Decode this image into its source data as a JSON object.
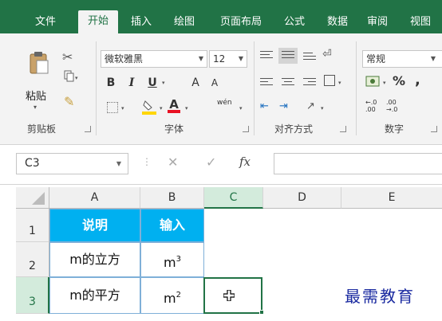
{
  "tabs": [
    {
      "label": "文件",
      "active": false
    },
    {
      "label": "开始",
      "active": true
    },
    {
      "label": "插入",
      "active": false
    },
    {
      "label": "绘图",
      "active": false
    },
    {
      "label": "页面布局",
      "active": false
    },
    {
      "label": "公式",
      "active": false
    },
    {
      "label": "数据",
      "active": false
    },
    {
      "label": "审阅",
      "active": false
    },
    {
      "label": "视图",
      "active": false
    }
  ],
  "ribbon": {
    "clipboard": {
      "paste_label": "粘贴",
      "group_label": "剪贴板"
    },
    "font": {
      "font_name": "微软雅黑",
      "font_size": "12",
      "group_label": "字体",
      "bold": "B",
      "italic": "I",
      "underline": "U",
      "grow": "A",
      "shrink": "A",
      "phonetic": "wén"
    },
    "alignment": {
      "group_label": "对齐方式"
    },
    "number": {
      "format": "常规",
      "percent": "%",
      "comma": ",",
      "inc_decimal": "←.0\n.00",
      "dec_decimal": ".00\n→.0",
      "group_label": "数字"
    }
  },
  "formula_bar": {
    "name_box": "C3",
    "cancel": "✕",
    "enter": "✓",
    "fx": "fx",
    "formula": ""
  },
  "columns": [
    "A",
    "B",
    "C",
    "D",
    "E"
  ],
  "rows": [
    "1",
    "2",
    "3"
  ],
  "table": {
    "headers": [
      "说明",
      "输入"
    ],
    "rows": [
      {
        "desc": "m的立方",
        "base": "m",
        "sup": "3"
      },
      {
        "desc": "m的平方",
        "base": "m",
        "sup": "2"
      }
    ]
  },
  "active_cell": "C3",
  "watermark": "最需教育",
  "colors": {
    "accent": "#217346",
    "header_fill": "#00b0f0"
  }
}
